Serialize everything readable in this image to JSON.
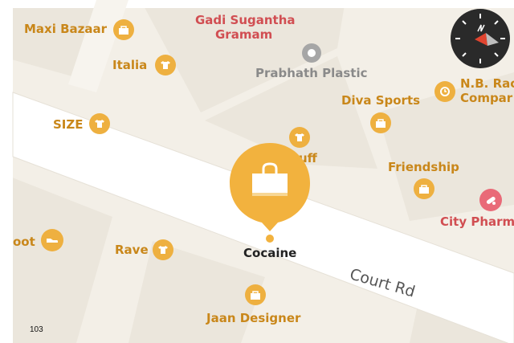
{
  "map": {
    "road_label": "Court Rd",
    "scale_label": "103",
    "selected_place": "Cocaine",
    "pois": [
      {
        "id": "maxi-bazaar",
        "label": "Maxi Bazaar",
        "category": "shopping-bag-icon",
        "color": "#e8a93a"
      },
      {
        "id": "gadi-sugantha-gramam",
        "label_line1": "Gadi Sugantha",
        "label_line2": "Gramam",
        "color": "#d14e52"
      },
      {
        "id": "italia",
        "label": "Italia",
        "category": "shirt-icon",
        "color": "#e8a93a"
      },
      {
        "id": "prabhath-plastic",
        "label": "Prabhath Plastic",
        "category": "dot-icon",
        "color": "#9a9a9a"
      },
      {
        "id": "nb-rad-company",
        "label_line1": "N.B. Rac",
        "label_line2": "Compar",
        "category": "watch-icon",
        "color": "#e8a93a"
      },
      {
        "id": "diva-sports",
        "label": "Diva Sports",
        "category": "shopping-bag-icon",
        "color": "#e8a93a"
      },
      {
        "id": "size",
        "label": "SIZE",
        "category": "shirt-icon",
        "color": "#e8a93a"
      },
      {
        "id": "partial-uff",
        "label": "uff",
        "category": "shirt-icon",
        "color": "#e8a93a"
      },
      {
        "id": "friendship",
        "label": "Friendship",
        "category": "shopping-bag-icon",
        "color": "#e8a93a"
      },
      {
        "id": "city-pharm",
        "label": "City Pharm",
        "category": "pills-icon",
        "color": "#e96a78"
      },
      {
        "id": "partial-oot",
        "label": "oot",
        "category": "shoe-icon",
        "color": "#e8a93a"
      },
      {
        "id": "rave",
        "label": "Rave",
        "category": "shirt-icon",
        "color": "#e8a93a"
      },
      {
        "id": "jaan-designer",
        "label": "Jaan Designer",
        "category": "shopping-bag-icon",
        "color": "#e8a93a"
      }
    ],
    "colors": {
      "land": "#f3efe7",
      "block": "#ebe6dc",
      "road": "#ffffff",
      "accent": "#f2b23e",
      "compass_bg": "#2a2a2a",
      "compass_needle": "#e0442f"
    }
  }
}
